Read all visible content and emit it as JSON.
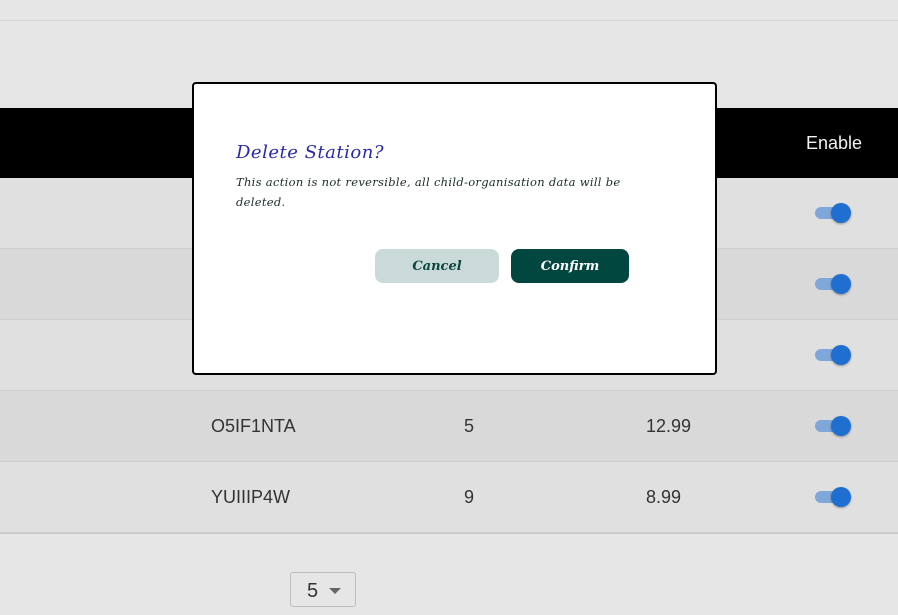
{
  "table": {
    "header": {
      "enable_label": "Enable"
    },
    "rows": [
      {
        "code": "",
        "qty": "",
        "price": "",
        "enabled": true
      },
      {
        "code": "",
        "qty": "",
        "price": "",
        "enabled": true
      },
      {
        "code": "",
        "qty": "",
        "price": "",
        "enabled": true
      },
      {
        "code": "O5IF1NTA",
        "qty": "5",
        "price": "12.99",
        "enabled": true
      },
      {
        "code": "YUIIIP4W",
        "qty": "9",
        "price": "8.99",
        "enabled": true
      }
    ]
  },
  "pagination": {
    "rows_per_page": "5",
    "caret_icon": "chevron-down-icon"
  },
  "dialog": {
    "title": "Delete Station?",
    "body": "This action is not reversible, all child-organisation data will be deleted.",
    "cancel_label": "Cancel",
    "confirm_label": "Confirm"
  },
  "colors": {
    "header_bg": "#000000",
    "toggle_on": "#1f6fd1",
    "title_color": "#2a2aa8",
    "confirm_bg": "#024640",
    "cancel_bg": "#c9dad8"
  }
}
